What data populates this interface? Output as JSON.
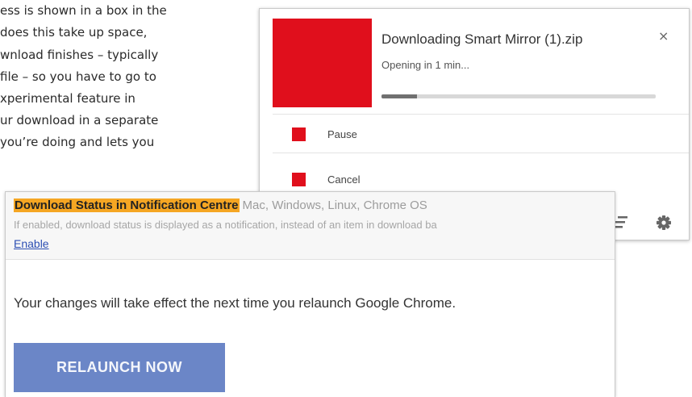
{
  "article": {
    "lines": [
      "ess is shown in a box in the",
      " does this take up space,",
      "wnload finishes – typically",
      "file – so you have to go to",
      "xperimental feature in",
      "ur download in a separate",
      "you’re doing and lets you"
    ]
  },
  "notification": {
    "title": "Downloading Smart Mirror (1).zip",
    "status": "Opening in 1 min...",
    "close_glyph": "×",
    "progress_fraction": 0.13,
    "thumbnail_color": "#e00f1c",
    "actions": [
      {
        "label": "Pause"
      },
      {
        "label": "Cancel"
      }
    ],
    "icons": [
      "clear-all-icon",
      "gear-icon"
    ]
  },
  "flags": {
    "experiment_name": "Download Status in Notification Centre",
    "platforms": "Mac, Windows, Linux, Chrome OS",
    "description": "If enabled, download status is displayed as a notification, instead of an item in download ba",
    "enable_label": "Enable",
    "relaunch_message": "Your changes will take effect the next time you relaunch Google Chrome.",
    "relaunch_button": "RELAUNCH NOW",
    "highlight_color": "#f5a623",
    "button_color": "#6b86c7"
  }
}
